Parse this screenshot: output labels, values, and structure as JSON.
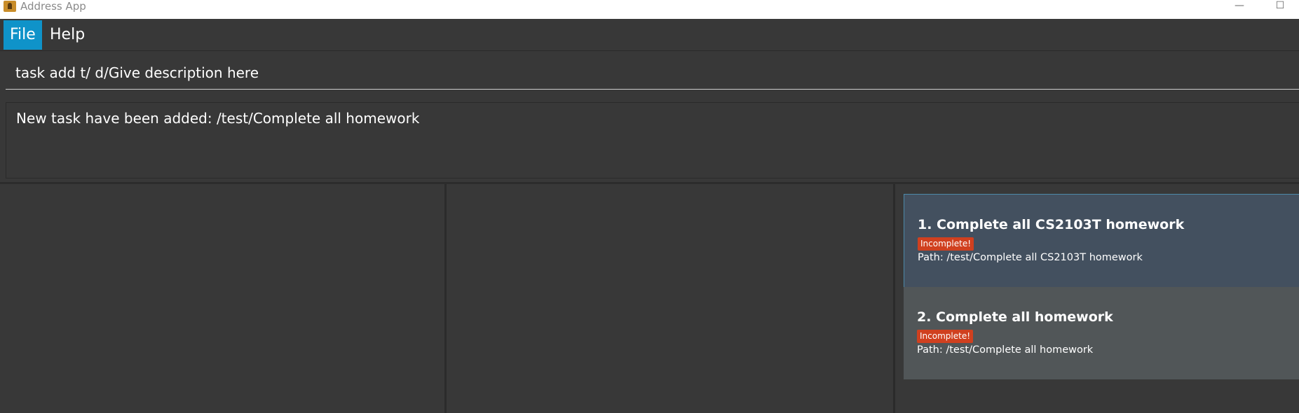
{
  "window": {
    "title": "Address App",
    "minimize_glyph": "—",
    "maximize_glyph": "☐"
  },
  "menu": {
    "items": [
      {
        "label": "File",
        "active": true
      },
      {
        "label": "Help",
        "active": false
      }
    ]
  },
  "command": {
    "value": "task add t/ d/Give description here"
  },
  "result": {
    "text": "New task have been added: /test/Complete all homework"
  },
  "tasks": [
    {
      "title": "1.  Complete all CS2103T homework",
      "status": "Incomplete!",
      "path": "Path: /test/Complete all CS2103T homework",
      "selected": true
    },
    {
      "title": "2.  Complete all homework",
      "status": "Incomplete!",
      "path": "Path: /test/Complete all homework",
      "selected": false
    }
  ],
  "colors": {
    "background": "#383838",
    "menu_active": "#0f93c9",
    "selected_card": "#43505f",
    "card": "#515658",
    "badge": "#d0401f"
  }
}
